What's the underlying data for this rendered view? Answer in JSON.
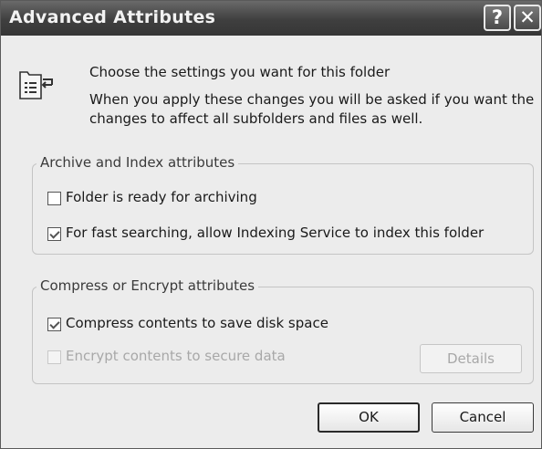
{
  "window": {
    "title": "Advanced Attributes",
    "help_glyph": "?",
    "close_glyph": "✕"
  },
  "intro": {
    "icon": "folder-settings-icon",
    "line1": "Choose the settings you want for this folder",
    "line2": "When you apply these changes you will be asked if you want the",
    "line3": "changes to affect all subfolders and files as well."
  },
  "archive_group": {
    "legend": "Archive and Index attributes",
    "options": [
      {
        "label": "Folder is ready for archiving",
        "checked": false,
        "enabled": true
      },
      {
        "label": "For fast searching, allow Indexing Service to index this folder",
        "checked": true,
        "enabled": true
      }
    ]
  },
  "compress_group": {
    "legend": "Compress or Encrypt attributes",
    "options": [
      {
        "label": "Compress contents to save disk space",
        "checked": true,
        "enabled": true
      },
      {
        "label": "Encrypt contents to secure data",
        "checked": false,
        "enabled": false
      }
    ],
    "details_label": "Details"
  },
  "buttons": {
    "ok_label": "OK",
    "cancel_label": "Cancel"
  }
}
